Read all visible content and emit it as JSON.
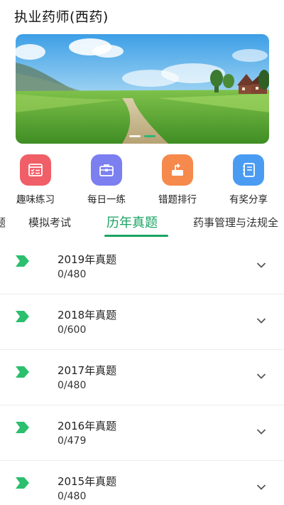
{
  "header": {
    "title": "执业药师(西药)"
  },
  "banner": {
    "dots": 2,
    "active_dot": 2
  },
  "features": [
    {
      "label": "趣味练习",
      "icon": "practice-icon",
      "color": "#f05f67"
    },
    {
      "label": "每日一练",
      "icon": "briefcase-icon",
      "color": "#7b7ff0"
    },
    {
      "label": "错题排行",
      "icon": "ranking-icon",
      "color": "#f6894c"
    },
    {
      "label": "有奖分享",
      "icon": "share-notebook-icon",
      "color": "#4a9cf2"
    }
  ],
  "tabs": [
    {
      "label": "题"
    },
    {
      "label": "模拟考试"
    },
    {
      "label": "历年真题",
      "active": true
    },
    {
      "label": "药事管理与法规全"
    }
  ],
  "accent_color": "#1aa362",
  "papers": [
    {
      "title": "2019年真题",
      "progress": "0/480"
    },
    {
      "title": "2018年真题",
      "progress": "0/600"
    },
    {
      "title": "2017年真题",
      "progress": "0/480"
    },
    {
      "title": "2016年真题",
      "progress": "0/479"
    },
    {
      "title": "2015年真题",
      "progress": "0/480"
    }
  ]
}
